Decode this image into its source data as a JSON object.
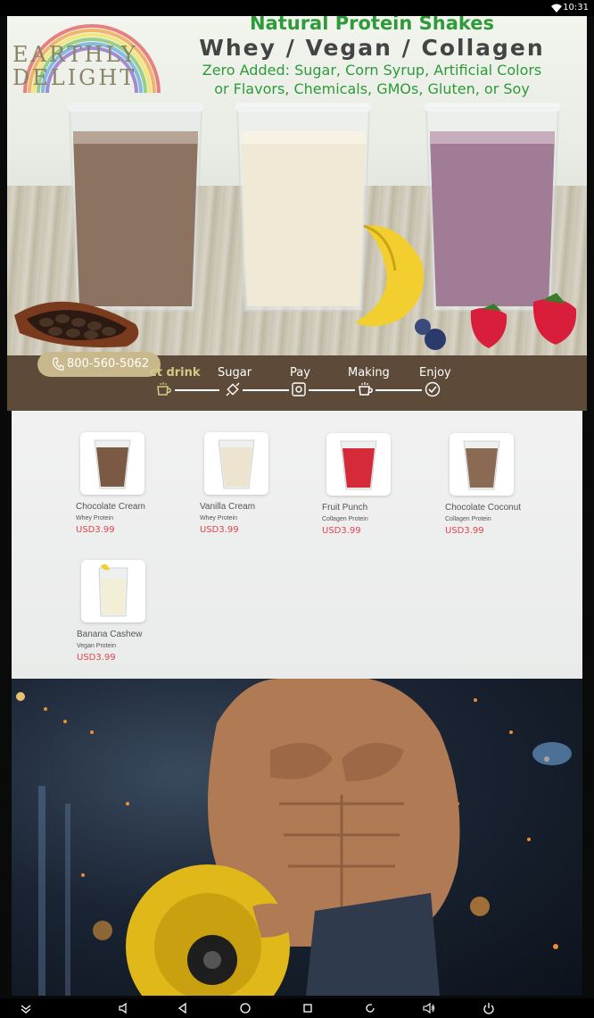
{
  "status_bar": {
    "time": "10:31",
    "wifi_icon": "wifi-icon"
  },
  "banner": {
    "brand_line1": "EARTHLY",
    "brand_line2": "DELIGHT",
    "headline": "Natural Protein Shakes",
    "subheadline": "Whey / Vegan / Collagen",
    "claim_line1": "Zero Added: Sugar, Corn Syrup, Artificial Colors",
    "claim_line2": "or Flavors, Chemicals, GMOs, Gluten, or Soy"
  },
  "process": {
    "phone": "800-560-5062",
    "steps": [
      {
        "label": "ct drink",
        "icon": "cup-icon",
        "active": true
      },
      {
        "label": "Sugar",
        "icon": "sugar-icon",
        "active": false
      },
      {
        "label": "Pay",
        "icon": "pay-icon",
        "active": false
      },
      {
        "label": "Making",
        "icon": "making-icon",
        "active": false
      },
      {
        "label": "Enjoy",
        "icon": "check-icon",
        "active": false
      }
    ]
  },
  "products": [
    {
      "name": "Chocolate Cream",
      "category": "Whey Protein",
      "price": "USD3.99",
      "color": "#7a5a44"
    },
    {
      "name": "Vanilla Cream",
      "category": "Whey Protein",
      "price": "USD3.99",
      "color": "#ece4cf"
    },
    {
      "name": "Fruit Punch",
      "category": "Collagen Protein",
      "price": "USD3.99",
      "color": "#d42a3a"
    },
    {
      "name": "Chocolate Coconut",
      "category": "Collagen Protein",
      "price": "USD3.99",
      "color": "#8a6a52"
    },
    {
      "name": "Banana Cashew",
      "category": "Vegan Protein",
      "price": "USD3.99",
      "color": "#f3eed6"
    }
  ],
  "colors": {
    "headline_green": "#2e9a3a",
    "process_bar": "#5e4a38",
    "phone_pill": "#c9b88c",
    "price_red": "#e0454a"
  },
  "nav_bar": {
    "buttons": [
      "collapse-icon",
      "volume-down-icon",
      "back-icon",
      "home-icon",
      "recents-icon",
      "rotate-icon",
      "volume-up-icon",
      "power-icon"
    ]
  }
}
